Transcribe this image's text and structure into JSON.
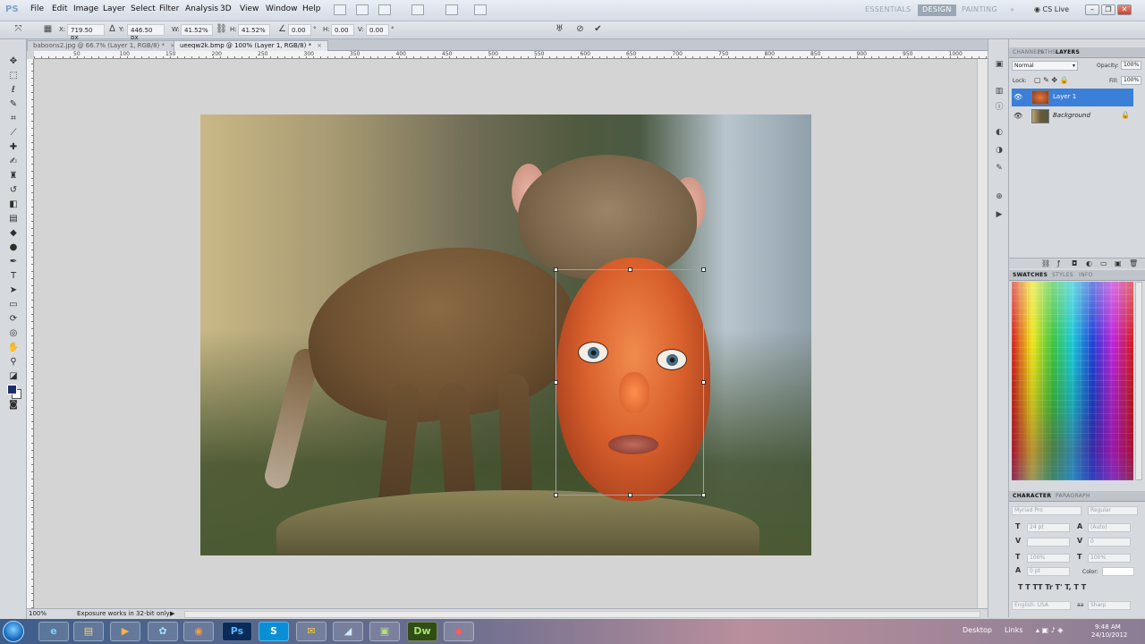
{
  "menubar": {
    "logo": "PS",
    "items": [
      "File",
      "Edit",
      "Image",
      "Layer",
      "Select",
      "Filter",
      "Analysis",
      "3D",
      "View",
      "Window",
      "Help"
    ],
    "workspaces": [
      "ESSENTIALS",
      "DESIGN",
      "PAINTING"
    ],
    "active_workspace": "DESIGN",
    "cs_live": "CS Live",
    "more": "»"
  },
  "options": {
    "x_label": "X:",
    "x_value": "719.50 px",
    "y_label": "Y:",
    "y_value": "446.50 px",
    "w_label": "W:",
    "w_value": "41.52%",
    "h_label": "H:",
    "h_value": "41.52%",
    "angle_value": "0.00",
    "hskew_label": "H:",
    "hskew_value": "0.00",
    "vskew_label": "V:",
    "vskew_value": "0.00",
    "degree_sign": "°",
    "cancel_icon": "⊘",
    "commit_icon": "✔"
  },
  "tabs": [
    {
      "label": "baboons2.jpg @ 66.7% (Layer 1, RGB/8) *",
      "active": false
    },
    {
      "label": "ueeqw2k.bmp @ 100% (Layer 1, RGB/8) *",
      "active": true
    }
  ],
  "ruler": {
    "ticks": [
      "50",
      "100",
      "150",
      "200",
      "250",
      "300",
      "350",
      "400",
      "450",
      "500",
      "550",
      "600",
      "650",
      "700",
      "750",
      "800",
      "850",
      "900",
      "950",
      "1000"
    ]
  },
  "status": {
    "zoom": "100%",
    "info": "Exposure works in 32-bit only"
  },
  "panels": {
    "top_tabs": [
      "CHANNELS",
      "PATHS",
      "LAYERS"
    ],
    "active_top": "LAYERS",
    "blend_mode": "Normal",
    "opacity_label": "Opacity:",
    "opacity_value": "100%",
    "lock_label": "Lock:",
    "fill_label": "Fill:",
    "fill_value": "100%",
    "layers": [
      {
        "name": "Layer 1",
        "selected": true,
        "locked": false
      },
      {
        "name": "Background",
        "selected": false,
        "locked": true
      }
    ],
    "mid_tabs": [
      "SWATCHES",
      "STYLES",
      "INFO"
    ],
    "active_mid": "SWATCHES",
    "char_tabs": [
      "CHARACTER",
      "PARAGRAPH"
    ],
    "active_char": "CHARACTER",
    "font_family": "Myriad Pro",
    "font_style": "Regular",
    "font_size": "24 pt",
    "leading": "(Auto)",
    "tracking": "0",
    "vscale": "100%",
    "hscale": "100%",
    "baseline": "0 pt",
    "color_label": "Color:",
    "language": "English: USA",
    "antialias": "Sharp"
  },
  "taskbar": {
    "desktop": "Desktop",
    "links": "Links",
    "time": "9:48 AM",
    "date": "24/10/2012",
    "apps": [
      "e",
      "▤",
      "▶",
      "✿",
      "◉",
      "Ps",
      "S",
      "✉",
      "◢",
      "▣",
      "Dw",
      "◆"
    ]
  },
  "colors": {
    "accent": "#3b7fd9",
    "foreground": "#1d2f6b",
    "background": "#ffffff"
  }
}
